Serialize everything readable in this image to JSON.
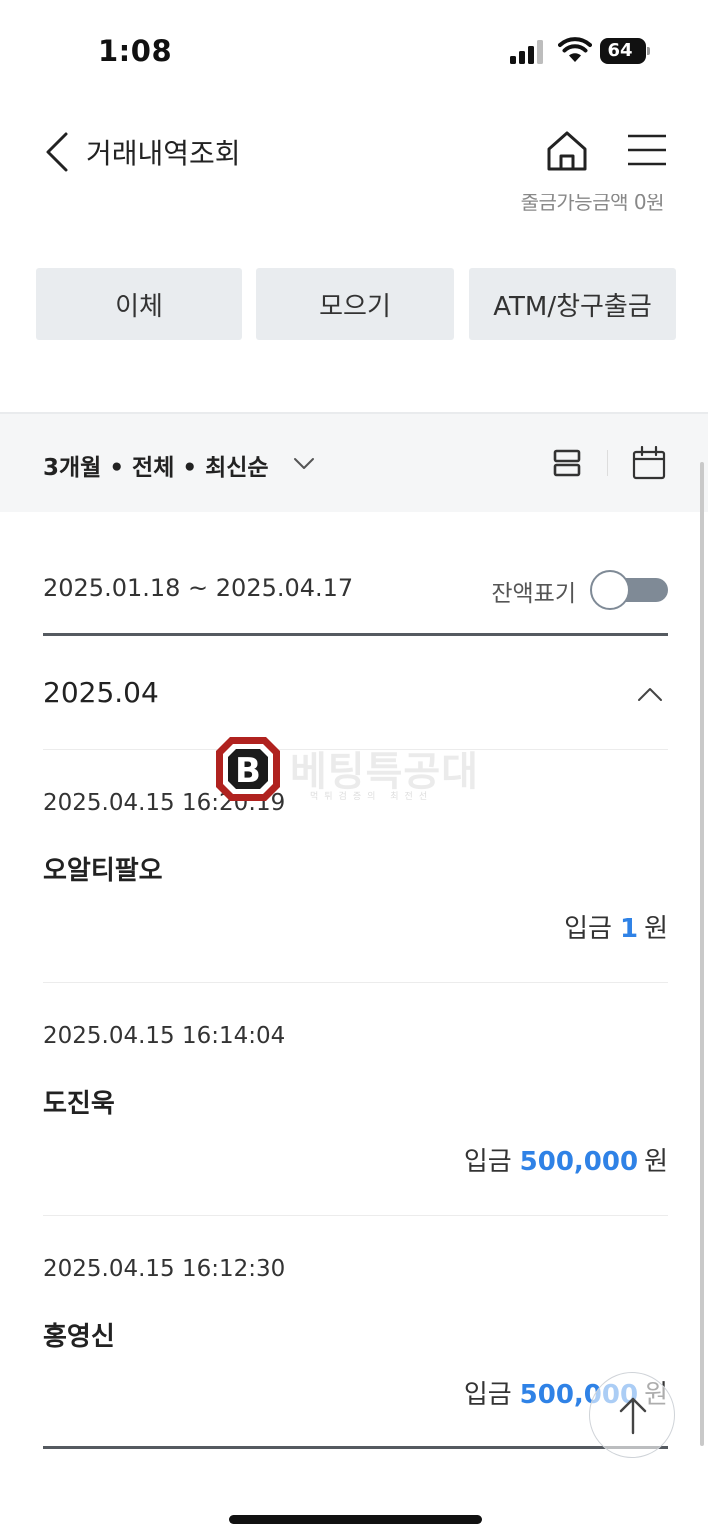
{
  "status_bar": {
    "time": "1:08",
    "battery": "64"
  },
  "header": {
    "title": "거래내역조회",
    "back_icon": "chevron-left-icon",
    "home_icon": "home-icon",
    "menu_icon": "hamburger-menu-icon"
  },
  "balance_line": "출금가능금액 0원",
  "actions": [
    {
      "label": "이체"
    },
    {
      "label": "모으기"
    },
    {
      "label": "ATM/창구출금"
    }
  ],
  "filter": {
    "summary": "3개월 • 전체 • 최신순"
  },
  "period": {
    "range": "2025.01.18 ~ 2025.04.17",
    "balance_toggle_label": "잔액표기",
    "balance_toggle_on": false
  },
  "month": {
    "label": "2025.04"
  },
  "transactions": [
    {
      "datetime": "2025.04.15 16:20:19",
      "name": "오알티팔오",
      "type": "입금",
      "amount": "1",
      "unit": "원"
    },
    {
      "datetime": "2025.04.15 16:14:04",
      "name": "도진욱",
      "type": "입금",
      "amount": "500,000",
      "unit": "원"
    },
    {
      "datetime": "2025.04.15 16:12:30",
      "name": "홍영신",
      "type": "입금",
      "amount": "500,000",
      "unit": "원"
    }
  ],
  "watermark": {
    "text": "베팅특공대",
    "sub": "먹튀검증의 최전선"
  },
  "colors": {
    "accent_amount": "#2f82e6",
    "button_bg": "#e9ecef",
    "filter_bg": "#f5f6f7",
    "toggle": "#7f8a96"
  }
}
